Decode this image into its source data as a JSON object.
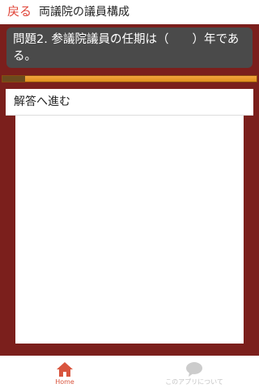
{
  "header": {
    "back_label": "戻る",
    "title": "両議院の議員構成"
  },
  "question": {
    "text": "問題2. 参議院議員の任期は（　　）年である。"
  },
  "progress": {
    "fraction": 0.09
  },
  "answer_button": {
    "label": "解答へ進む"
  },
  "tabbar": {
    "home_label": "Home",
    "home_icon": "home-icon",
    "about_label": "このアプリについて",
    "about_icon": "speech-bubble-icon"
  },
  "colors": {
    "accent": "#e0463a",
    "frame": "#7b1f1c",
    "question_bg": "#4a4a4a",
    "progress": "#f0a030"
  }
}
